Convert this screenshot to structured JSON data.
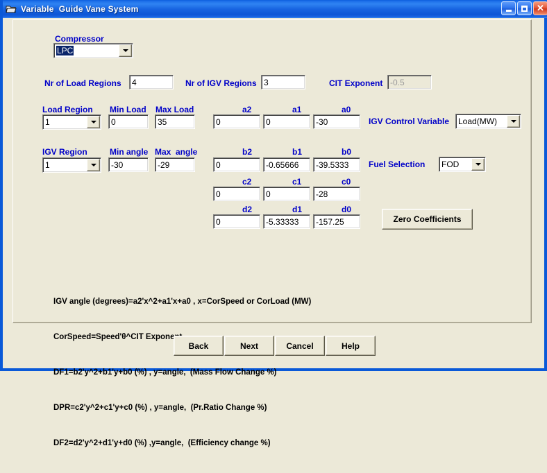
{
  "window": {
    "title": "Variable  Guide Vane System",
    "icon": "folder-icon",
    "minimize_label": "",
    "maximize_label": "",
    "close_label": "✕",
    "titlebar_color": "#0a59d8",
    "face_color": "#ece9d8",
    "label_color": "#0000c8"
  },
  "fields": {
    "compressor": {
      "label": "Compressor",
      "value": "LPC"
    },
    "nr_load_regions": {
      "label": "Nr of Load Regions",
      "value": "4"
    },
    "nr_igv_regions": {
      "label": "Nr of IGV Regions",
      "value": "3"
    },
    "cit_exponent": {
      "label": "CIT Exponent",
      "value": "-0.5",
      "disabled": true
    },
    "load_region": {
      "label": "Load Region",
      "value": "1"
    },
    "min_load": {
      "label": "Min Load",
      "value": "0"
    },
    "max_load": {
      "label": "Max Load",
      "value": "35"
    },
    "a2": {
      "label": "a2",
      "value": "0"
    },
    "a1": {
      "label": "a1",
      "value": "0"
    },
    "a0": {
      "label": "a0",
      "value": "-30"
    },
    "igv_control_variable": {
      "label": "IGV Control Variable",
      "value": "Load(MW)"
    },
    "igv_region": {
      "label": "IGV Region",
      "value": "1"
    },
    "min_angle": {
      "label": "Min angle",
      "value": "-30"
    },
    "max_angle": {
      "label": "Max  angle",
      "value": "-29"
    },
    "b2": {
      "label": "b2",
      "value": "0"
    },
    "b1": {
      "label": "b1",
      "value": "-0.65666"
    },
    "b0": {
      "label": "b0",
      "value": "-39.5333"
    },
    "fuel_selection": {
      "label": "Fuel Selection",
      "value": "FOD"
    },
    "c2": {
      "label": "c2",
      "value": "0"
    },
    "c1": {
      "label": "c1",
      "value": "0"
    },
    "c0": {
      "label": "c0",
      "value": "-28"
    },
    "d2": {
      "label": "d2",
      "value": "0"
    },
    "d1": {
      "label": "d1",
      "value": "-5.33333"
    },
    "d0": {
      "label": "d0",
      "value": "-157.25"
    }
  },
  "buttons": {
    "zero_coefficients": "Zero Coefficients",
    "back": "Back",
    "next": "Next",
    "cancel": "Cancel",
    "help": "Help"
  },
  "formula": {
    "line1": "IGV angle (degrees)=a2'x^2+a1'x+a0 , x=CorSpeed or CorLoad (MW)",
    "line2": "CorSpeed=Speed'θ^CIT Exponent",
    "line3": "DF1=b2'y^2+b1'y+b0 (%) , y=angle,  (Mass Flow Change %)",
    "line4": "DPR=c2'y^2+c1'y+c0 (%) , y=angle,  (Pr.Ratio Change %)",
    "line5": "DF2=d2'y^2+d1'y+d0 (%) ,y=angle,  (Efficiency change %)"
  }
}
